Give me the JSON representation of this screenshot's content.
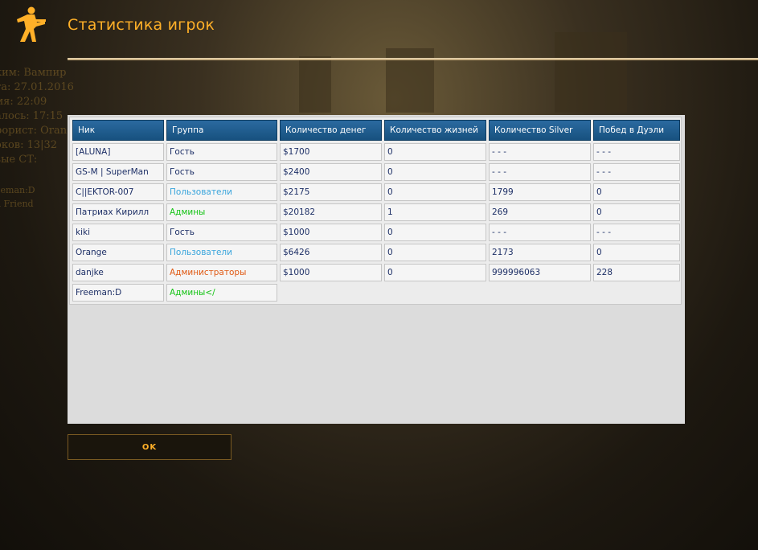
{
  "header": {
    "title": "Статистика игрок"
  },
  "background_hud": {
    "lines": [
      "ким: Вампир",
      "та: 27.01.2016",
      "мя: 22:09",
      "алось: 17:15",
      "рорист: Oran",
      "оков: 13|32",
      "зые СТ:"
    ],
    "players": [
      "eeman:D",
      "d Friend"
    ]
  },
  "table": {
    "headers": [
      "Ник",
      "Группа",
      "Количество денег",
      "Количество жизней",
      "Количество Silver",
      "Побед в Дуэли"
    ],
    "rows": [
      {
        "nick": "[ALUNA]",
        "group": "Гость",
        "group_type": "guest",
        "money": "$1700",
        "lives": "0",
        "silver": "- - -",
        "duels": "- - -"
      },
      {
        "nick": "GS-M | SuperMan",
        "group": "Гость",
        "group_type": "guest",
        "money": "$2400",
        "lives": "0",
        "silver": "- - -",
        "duels": "- - -"
      },
      {
        "nick": "C||EKTOR-007",
        "group": "Пользователи",
        "group_type": "users",
        "money": "$2175",
        "lives": "0",
        "silver": "1799",
        "duels": "0"
      },
      {
        "nick": "Патриах Кирилл",
        "group": "Админы",
        "group_type": "admins",
        "money": "$20182",
        "lives": "1",
        "silver": "269",
        "duels": "0"
      },
      {
        "nick": "kiki",
        "group": "Гость",
        "group_type": "guest",
        "money": "$1000",
        "lives": "0",
        "silver": "- - -",
        "duels": "- - -"
      },
      {
        "nick": "Orange",
        "group": "Пользователи",
        "group_type": "users",
        "money": "$6426",
        "lives": "0",
        "silver": "2173",
        "duels": "0"
      },
      {
        "nick": "danjke",
        "group": "Администраторы",
        "group_type": "administrators",
        "money": "$1000",
        "lives": "0",
        "silver": "999996063",
        "duels": "228"
      },
      {
        "nick": "Freeman:D",
        "group": "Админы</",
        "group_type": "admins",
        "partial": true
      }
    ]
  },
  "ok_button": {
    "label": "OK"
  },
  "colors": {
    "accent": "#ffb028",
    "header_cell": "#1f5f93",
    "guest": "#1d2f66",
    "users": "#3aa5dc",
    "admins": "#16c416",
    "administrators": "#e05a14"
  },
  "icons": {
    "logo": "counter-terrorist-icon"
  }
}
